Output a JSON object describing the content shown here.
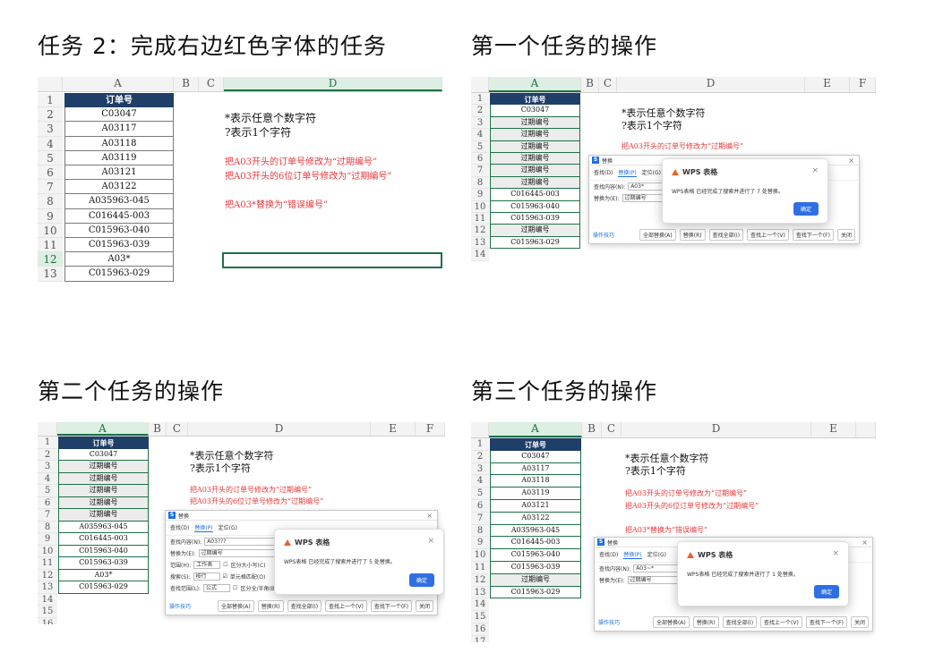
{
  "titles": {
    "t1": "任务 2：完成右边红色字体的任务",
    "t2": "第一个任务的操作",
    "t3": "第二个任务的操作",
    "t4": "第三个任务的操作"
  },
  "notes": {
    "star": "*表示任意个数字符",
    "q": "?表示1个字符",
    "r1": "把A03开头的订单号修改为“过期编号”",
    "r2": "把A03开头的6位订单号修改为“过期编号”",
    "r3": "把A03*替换为“错误编号”"
  },
  "columns": [
    "A",
    "B",
    "C",
    "D",
    "E",
    "F"
  ],
  "panel1": {
    "header": "订单号",
    "rows": [
      "C03047",
      "A03117",
      "A03118",
      "A03119",
      "A03121",
      "A03122",
      "A035963-045",
      "C016445-003",
      "C015963-040",
      "C015963-039",
      "A03*",
      "C015963-029"
    ]
  },
  "panel2": {
    "header": "订单号",
    "rows": [
      "C03047",
      "过期编号",
      "过期编号",
      "过期编号",
      "过期编号",
      "过期编号",
      "过期编号",
      "C016445-003",
      "C015963-040",
      "C015963-039",
      "过期编号",
      "C015963-029"
    ]
  },
  "panel3": {
    "header": "订单号",
    "rows": [
      "C03047",
      "过期编号",
      "过期编号",
      "过期编号",
      "过期编号",
      "过期编号",
      "A035963-045",
      "C016445-003",
      "C015963-040",
      "C015963-039",
      "A03*",
      "C015963-029"
    ]
  },
  "panel4": {
    "header": "订单号",
    "rows": [
      "C03047",
      "A03117",
      "A03118",
      "A03119",
      "A03121",
      "A03122",
      "A035963-045",
      "C016445-003",
      "C015963-040",
      "C015963-039",
      "过期编号",
      "C015963-029"
    ]
  },
  "dialog": {
    "title": "替换",
    "tabs": [
      "查找(D)",
      "替换(P)",
      "定位(G)"
    ],
    "find_label": "查找内容(N):",
    "replace_label": "替换为(E):",
    "replace_value": "过期编号",
    "find1": "A03*",
    "find2": "A03???",
    "find3": "A03~*",
    "scope_label": "范围(H):",
    "scope_value": "工作表",
    "search_label": "搜索(S):",
    "search_value": "按行",
    "range_label": "查找范围(L):",
    "range_value": "公式",
    "opt1": "区分大小写(C)",
    "opt2": "单元格匹配(O)",
    "opt3": "区分全/半角(B)",
    "options_btn": "选项(T) >>",
    "tip": "操作技巧",
    "buttons": [
      "全部替换(A)",
      "替换(R)",
      "查找全部(I)",
      "查找上一个(V)",
      "查找下一个(F)",
      "关闭"
    ]
  },
  "message": {
    "title": "WPS 表格",
    "body1": "WPS表格 已经完成了搜索并进行了 7 处替换。",
    "body2": "WPS表格 已经完成了搜索并进行了 5 处替换。",
    "body3": "WPS表格 已经完成了搜索并进行了 1 处替换。",
    "ok": "确定"
  }
}
